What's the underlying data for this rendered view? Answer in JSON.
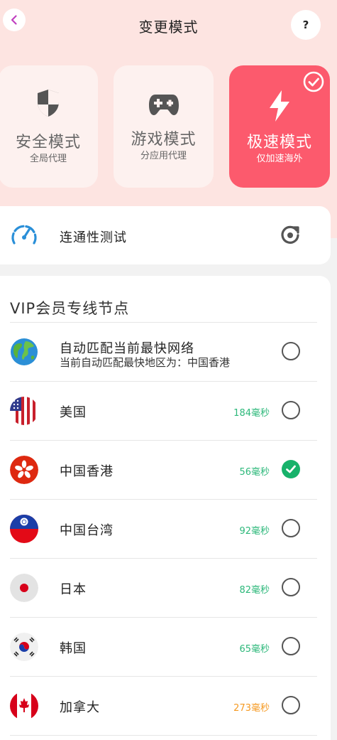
{
  "header": {
    "title": "变更模式",
    "help_label": "?"
  },
  "modes": [
    {
      "name": "安全模式",
      "sub": "全局代理",
      "icon": "shield-icon"
    },
    {
      "name": "游戏模式",
      "sub": "分应用代理",
      "icon": "gamepad-icon"
    },
    {
      "name": "极速模式",
      "sub": "仅加速海外",
      "icon": "lightning-icon",
      "selected": true
    }
  ],
  "connectivity": {
    "label": "连通性测试"
  },
  "nodes": {
    "title": "VIP会员专线节点",
    "items": [
      {
        "name": "自动匹配当前最快网络",
        "sub": "当前自动匹配最快地区为：中国香港",
        "latency": "",
        "selected": false,
        "icon": "globe-icon"
      },
      {
        "name": "美国",
        "latency": "184毫秒",
        "selected": false,
        "icon": "us-flag-icon"
      },
      {
        "name": "中国香港",
        "latency": "56毫秒",
        "selected": true,
        "icon": "hk-flag-icon"
      },
      {
        "name": "中国台湾",
        "latency": "92毫秒",
        "selected": false,
        "icon": "tw-flag-icon"
      },
      {
        "name": "日本",
        "latency": "82毫秒",
        "selected": false,
        "icon": "jp-flag-icon"
      },
      {
        "name": "韩国",
        "latency": "65毫秒",
        "selected": false,
        "icon": "kr-flag-icon"
      },
      {
        "name": "加拿大",
        "latency": "273毫秒",
        "selected": false,
        "icon": "ca-flag-icon"
      }
    ]
  },
  "colors": {
    "accent": "#fc5a6d",
    "header_bg": "#fde4e1",
    "ok": "#17b26a",
    "latency_good": "#2cb87a",
    "latency_warn": "#f59a23"
  }
}
